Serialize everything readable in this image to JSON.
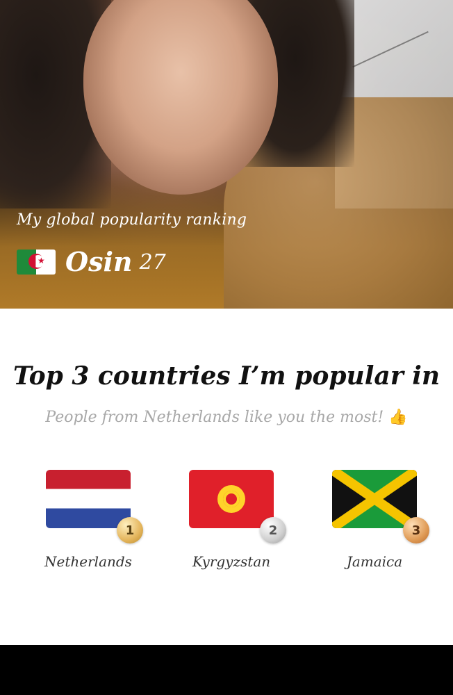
{
  "hero": {
    "caption": "My global popularity ranking",
    "flag_country": "Algeria",
    "name": "Osin",
    "age": "27"
  },
  "card": {
    "title": "Top 3 countries I’m popular in",
    "subtitle": "People from Netherlands like you the most!",
    "subtitle_emoji": "👍",
    "countries": [
      {
        "name": "Netherlands",
        "rank": "1",
        "medal": "gold"
      },
      {
        "name": "Kyrgyzstan",
        "rank": "2",
        "medal": "silver"
      },
      {
        "name": "Jamaica",
        "rank": "3",
        "medal": "bronze"
      }
    ]
  },
  "colors": {
    "hero_gradient": "#b07a28",
    "title_text": "#111111",
    "subtitle_text": "#a8a8a8"
  }
}
